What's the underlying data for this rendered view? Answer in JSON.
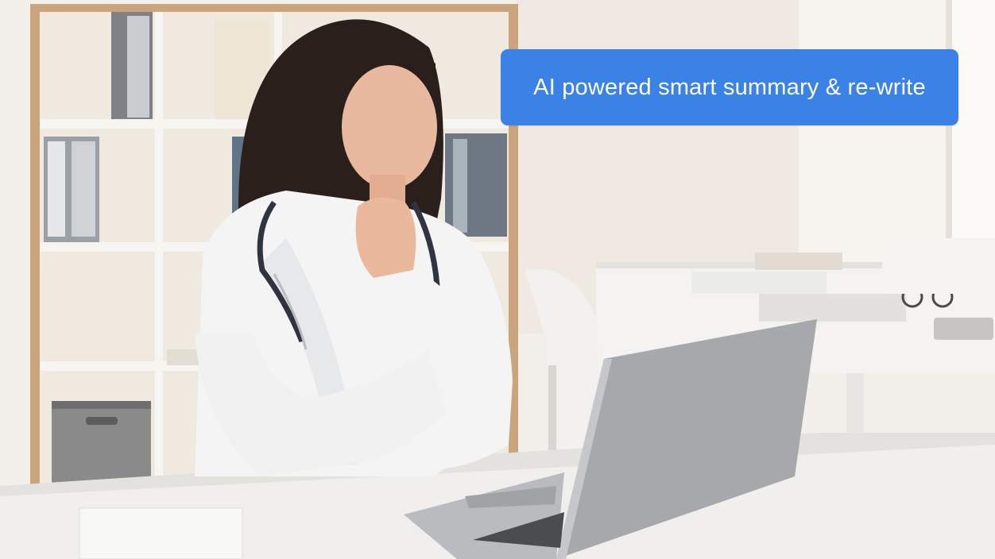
{
  "caption": {
    "text": "AI powered smart summary & re-write",
    "background_color": "#3b82e6",
    "text_color": "#ffffff"
  },
  "photo": {
    "subject": "person-at-laptop"
  }
}
